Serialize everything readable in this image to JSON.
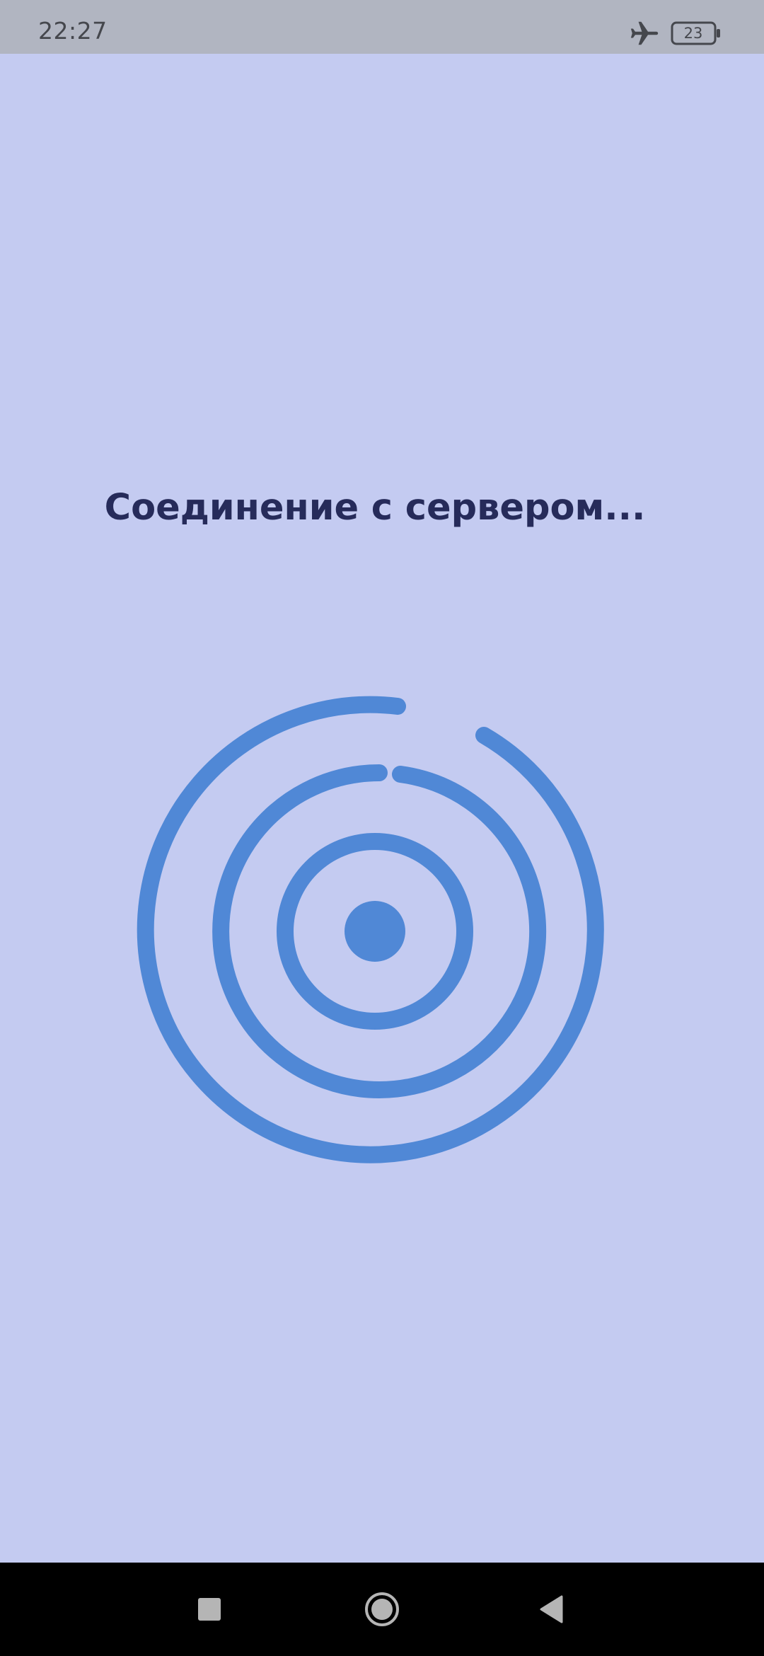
{
  "status_bar": {
    "time": "22:27",
    "battery_level": "23",
    "icons": [
      "airplane-mode-icon",
      "battery-icon"
    ]
  },
  "main": {
    "title": "Соединение с сервером..."
  },
  "loader": {
    "icon": "radar-loading-icon",
    "color": "#5088d6"
  },
  "nav_bar": {
    "buttons": [
      "recents",
      "home",
      "back"
    ]
  },
  "colors": {
    "background": "#c4cbf1",
    "status_bar": "#b1b5c1",
    "title": "#262b5a",
    "accent": "#5088d6",
    "nav_bar": "#000000"
  }
}
